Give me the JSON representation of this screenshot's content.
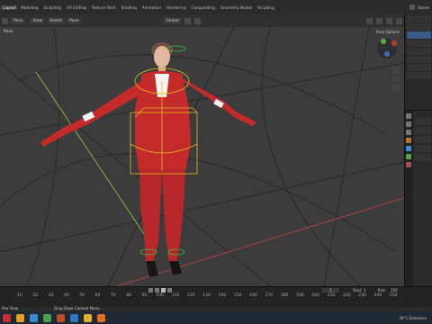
{
  "topbar": {
    "tabs": [
      "Layout",
      "Modeling",
      "Sculpting",
      "UV Editing",
      "Texture Paint",
      "Shading",
      "Animation",
      "Rendering",
      "Compositing",
      "Geometry Nodes",
      "Scripting"
    ],
    "active_tab": 0,
    "scene_label": "Scene"
  },
  "viewport_header": {
    "mode": "Pose",
    "orientation": "Global",
    "options_label": "Pose Options"
  },
  "timeline": {
    "ticks": [
      "10",
      "20",
      "30",
      "40",
      "50",
      "60",
      "70",
      "80",
      "90",
      "100",
      "110",
      "120",
      "130",
      "140",
      "150",
      "160",
      "170",
      "180",
      "190",
      "200",
      "210",
      "220",
      "230",
      "240",
      "250"
    ],
    "start_label": "Start",
    "start_value": "1",
    "end_label": "End",
    "end_value": "250",
    "current_frame": "1"
  },
  "status": {
    "left": "Pan View",
    "mid": "Drag Dope Context Menu"
  },
  "taskbar": {
    "weather": "30°C Extensive",
    "time": "",
    "date": ""
  },
  "colors": {
    "accent": "#e68a2e",
    "suit": "#c42a2a",
    "viewport": "#3c3c3c",
    "bone": "#e0c020"
  }
}
